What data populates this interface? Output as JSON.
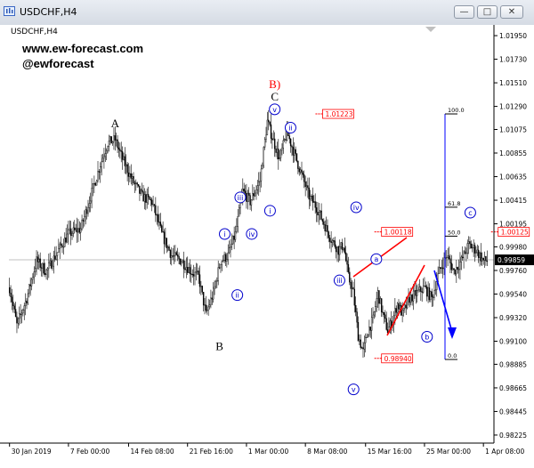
{
  "window": {
    "title": "USDCHF,H4",
    "buttons": [
      "minimize-button",
      "maximize-button",
      "close-button"
    ]
  },
  "chart_data": {
    "type": "candlestick",
    "symbol_label": "USDCHF,H4",
    "watermark_lines": [
      "www.ew-forecast.com",
      "@ewforecast"
    ],
    "current_price": "0.99859",
    "yaxis_ticks": [
      "1.01950",
      "1.01730",
      "1.01510",
      "1.01290",
      "1.01075",
      "1.00855",
      "1.00635",
      "1.00415",
      "1.00195",
      "0.99980",
      "0.99760",
      "0.99540",
      "0.99320",
      "0.99100",
      "0.98885",
      "0.98665",
      "0.98445",
      "0.98225"
    ],
    "xaxis_ticks": [
      "30 Jan 2019",
      "7 Feb 00:00",
      "14 Feb 08:00",
      "21 Feb 16:00",
      "1 Mar 00:00",
      "8 Mar 08:00",
      "15 Mar 16:00",
      "25 Mar 00:00",
      "1 Apr 08:00"
    ],
    "ylim": [
      0.9815,
      1.0205
    ],
    "path": [
      {
        "i": 0,
        "p": 0.996
      },
      {
        "i": 6,
        "p": 0.9925
      },
      {
        "i": 14,
        "p": 0.995
      },
      {
        "i": 22,
        "p": 0.9985
      },
      {
        "i": 30,
        "p": 0.9975
      },
      {
        "i": 40,
        "p": 0.9995
      },
      {
        "i": 48,
        "p": 1.001
      },
      {
        "i": 58,
        "p": 1.0015
      },
      {
        "i": 66,
        "p": 1.0045
      },
      {
        "i": 74,
        "p": 1.0075
      },
      {
        "i": 80,
        "p": 1.0095
      },
      {
        "i": 86,
        "p": 1.0098
      },
      {
        "i": 92,
        "p": 1.008
      },
      {
        "i": 100,
        "p": 1.006
      },
      {
        "i": 108,
        "p": 1.0045
      },
      {
        "i": 116,
        "p": 1.004
      },
      {
        "i": 124,
        "p": 1.001
      },
      {
        "i": 132,
        "p": 0.999
      },
      {
        "i": 140,
        "p": 0.9985
      },
      {
        "i": 148,
        "p": 0.9975
      },
      {
        "i": 154,
        "p": 0.997
      },
      {
        "i": 160,
        "p": 0.9935
      },
      {
        "i": 166,
        "p": 0.9955
      },
      {
        "i": 172,
        "p": 0.9985
      },
      {
        "i": 178,
        "p": 0.999
      },
      {
        "i": 184,
        "p": 1.001
      },
      {
        "i": 190,
        "p": 1.005
      },
      {
        "i": 196,
        "p": 1.004
      },
      {
        "i": 204,
        "p": 1.006
      },
      {
        "i": 210,
        "p": 1.0115
      },
      {
        "i": 214,
        "p": 1.01
      },
      {
        "i": 220,
        "p": 1.008
      },
      {
        "i": 226,
        "p": 1.0105
      },
      {
        "i": 232,
        "p": 1.0085
      },
      {
        "i": 238,
        "p": 1.0065
      },
      {
        "i": 244,
        "p": 1.0045
      },
      {
        "i": 250,
        "p": 1.0035
      },
      {
        "i": 256,
        "p": 1.002
      },
      {
        "i": 262,
        "p": 1.0005
      },
      {
        "i": 268,
        "p": 0.9995
      },
      {
        "i": 272,
        "p": 1.0
      },
      {
        "i": 276,
        "p": 0.997
      },
      {
        "i": 280,
        "p": 0.9955
      },
      {
        "i": 284,
        "p": 0.9915
      },
      {
        "i": 288,
        "p": 0.99
      },
      {
        "i": 292,
        "p": 0.992
      },
      {
        "i": 296,
        "p": 0.993
      },
      {
        "i": 300,
        "p": 0.9955
      },
      {
        "i": 304,
        "p": 0.9935
      },
      {
        "i": 308,
        "p": 0.992
      },
      {
        "i": 312,
        "p": 0.993
      },
      {
        "i": 316,
        "p": 0.9945
      },
      {
        "i": 320,
        "p": 0.9935
      },
      {
        "i": 326,
        "p": 0.995
      },
      {
        "i": 332,
        "p": 0.9955
      },
      {
        "i": 338,
        "p": 0.996
      },
      {
        "i": 344,
        "p": 0.995
      },
      {
        "i": 350,
        "p": 0.9975
      },
      {
        "i": 356,
        "p": 0.999
      },
      {
        "i": 362,
        "p": 0.9975
      },
      {
        "i": 368,
        "p": 0.9985
      },
      {
        "i": 374,
        "p": 1.0
      },
      {
        "i": 380,
        "p": 0.9995
      },
      {
        "i": 386,
        "p": 0.9985
      }
    ],
    "wave_labels": [
      {
        "text": "A",
        "style": "serif",
        "i": 86,
        "p": 1.0098
      },
      {
        "text": "B",
        "style": "serif",
        "i": 171,
        "p": 0.992
      },
      {
        "text": "B)",
        "style": "serif-red",
        "i": 216,
        "p": 1.0118
      },
      {
        "text": "C",
        "style": "serif",
        "i": 216,
        "p": 1.0118
      },
      {
        "text": "v",
        "style": "circle",
        "i": 216,
        "p": 1.0118
      },
      {
        "text": "ii",
        "style": "circle",
        "i": 226,
        "p": 1.0105
      },
      {
        "text": "iii",
        "style": "circle",
        "i": 201,
        "p": 1.0045
      },
      {
        "text": "i",
        "style": "circle",
        "i": 218,
        "p": 1.0045
      },
      {
        "text": "iv",
        "style": "circle",
        "i": 206,
        "p": 1.002
      },
      {
        "text": "i",
        "style": "circle",
        "i": 184,
        "p": 1.001
      },
      {
        "text": "ii",
        "style": "circle",
        "i": 187,
        "p": 0.9968
      },
      {
        "text": "iv",
        "style": "circle",
        "i": 286,
        "p": 1.001
      },
      {
        "text": "iii",
        "style": "circle",
        "i": 276,
        "p": 0.9975
      },
      {
        "text": "v",
        "style": "circle",
        "i": 286,
        "p": 0.989
      },
      {
        "text": "a",
        "style": "circle",
        "i": 306,
        "p": 0.997
      },
      {
        "text": "b",
        "style": "circle",
        "i": 335,
        "p": 0.991
      },
      {
        "text": "c",
        "style": "circle",
        "i": 384,
        "p": 1.0015
      }
    ],
    "price_boxes": [
      {
        "value": "1.01223",
        "i": 255,
        "p": 1.0122
      },
      {
        "value": "1.00118",
        "i": 303,
        "p": 1.0012
      },
      {
        "value": "0.98940",
        "i": 303,
        "p": 0.9894
      },
      {
        "value": "1.00125",
        "i": 398,
        "p": 1.0012
      }
    ],
    "fib_levels": [
      {
        "label": "100.0",
        "p": 1.0122
      },
      {
        "label": "61.8",
        "p": 1.0035
      },
      {
        "label": "50.0",
        "p": 1.0008
      },
      {
        "label": "0.0",
        "p": 0.9893
      }
    ],
    "colors": {
      "candle_bull": "#ffffff",
      "candle_bear": "#000000",
      "wick": "#000000",
      "annotation_blue": "#0000ff",
      "annotation_red": "#ff0000",
      "price_line": "#c0c0c0",
      "current_price_bg": "#000000",
      "circle_label": "#0000cc"
    }
  }
}
